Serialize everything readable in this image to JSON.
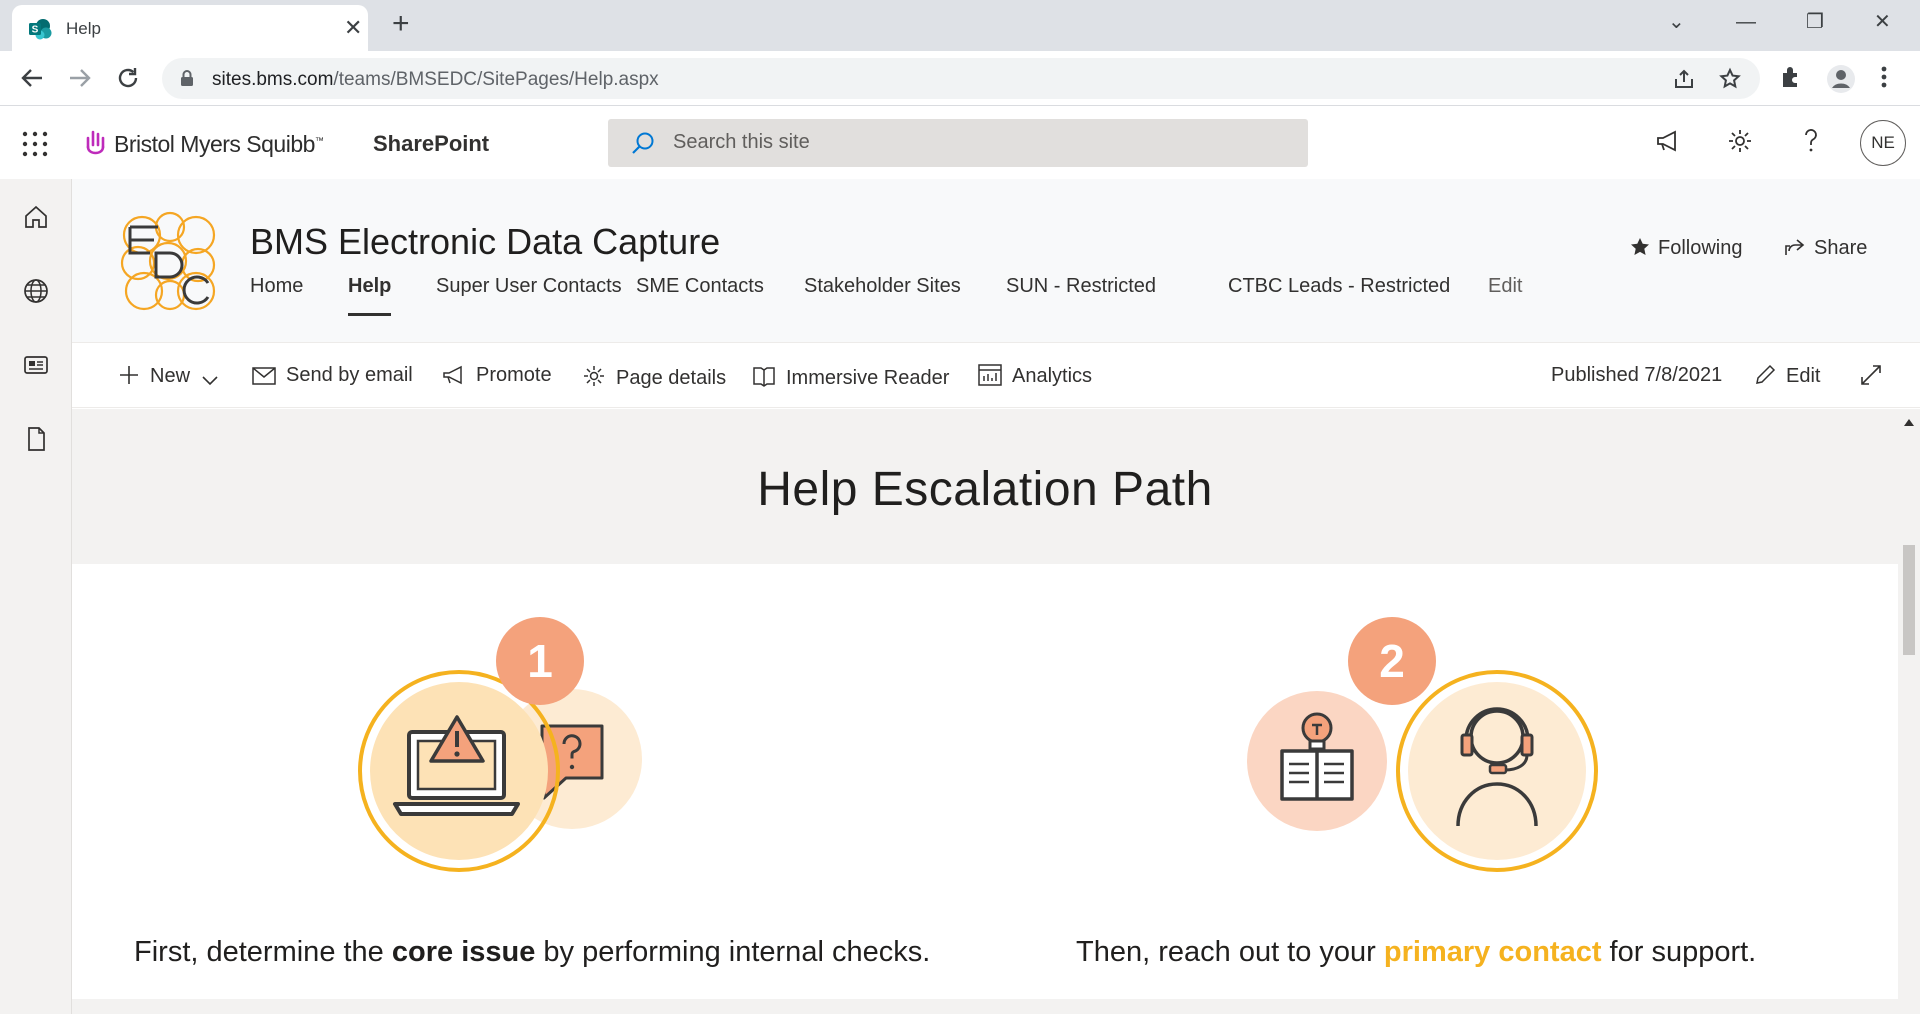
{
  "browser": {
    "tab_title": "Help",
    "tab_close": "✕",
    "new_tab": "+",
    "url_domain": "sites.bms.com",
    "url_path": "/teams/BMSEDC/SitePages/Help.aspx",
    "window_controls": [
      "⌄",
      "—",
      "❐",
      "✕"
    ]
  },
  "suite": {
    "company": "Bristol Myers Squibb",
    "trademark": "™",
    "app_name": "SharePoint",
    "search_placeholder": "Search this site",
    "user_initials": "NE"
  },
  "site": {
    "title": "BMS Electronic Data Capture",
    "logo_letters": "EDC",
    "nav": [
      {
        "label": "Home"
      },
      {
        "label": "Help",
        "active": true
      },
      {
        "label": "Super User Contacts"
      },
      {
        "label": "SME Contacts"
      },
      {
        "label": "Stakeholder Sites"
      },
      {
        "label": "SUN - Restricted"
      },
      {
        "label": "CTBC Leads - Restricted"
      },
      {
        "label": "Edit"
      }
    ],
    "following_label": "Following",
    "share_label": "Share"
  },
  "commandbar": {
    "new_label": "New",
    "send_email_label": "Send by email",
    "promote_label": "Promote",
    "page_details_label": "Page details",
    "immersive_reader_label": "Immersive Reader",
    "analytics_label": "Analytics",
    "published_label": "Published 7/8/2021",
    "edit_label": "Edit"
  },
  "page": {
    "heading": "Help Escalation Path",
    "steps": [
      {
        "number": "1",
        "text_before": "First, determine the ",
        "emphasis": "core issue",
        "text_after": " by performing internal checks."
      },
      {
        "number": "2",
        "text_before": "Then, reach out to your ",
        "emphasis": "primary contact",
        "text_after": " for support."
      }
    ]
  },
  "colors": {
    "accent_orange": "#f4a27c",
    "ring_yellow": "#f5b21f",
    "fill_peach": "#fde2b6",
    "fill_light": "#fdebd3",
    "highlight_text": "#f5b21f"
  }
}
